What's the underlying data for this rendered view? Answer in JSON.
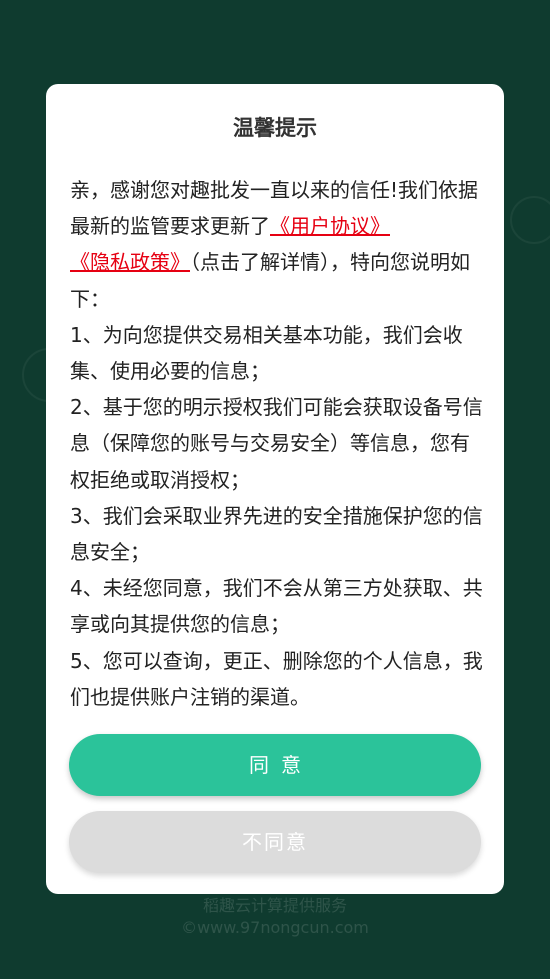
{
  "dialog": {
    "title": "温馨提示",
    "intro": "亲，感谢您对趣批发一直以来的信任!我们依据最新的监管要求更新了",
    "user_agreement_link": "《用户协议》",
    "privacy_policy_link": "《隐私政策》",
    "intro_tail": "（点击了解详情），特向您说明如下：",
    "items": [
      "1、为向您提供交易相关基本功能，我们会收集、使用必要的信息；",
      "2、基于您的明示授权我们可能会获取设备号信息（保障您的账号与交易安全）等信息，您有权拒绝或取消授权；",
      "3、我们会采取业界先进的安全措施保护您的信息安全；",
      "4、未经您同意，我们不会从第三方处获取、共享或向其提供您的信息；",
      "5、您可以查询，更正、删除您的个人信息，我们也提供账户注销的渠道。"
    ],
    "agree_label": "同意",
    "disagree_label": "不同意"
  },
  "footer": {
    "line1": "稻趣云计算提供服务",
    "line2": "©www.97nongcun.com"
  },
  "colors": {
    "background": "#0f3b2f",
    "accent": "#2bc39a",
    "link": "#e60012",
    "disabled": "#dcdcdc"
  }
}
